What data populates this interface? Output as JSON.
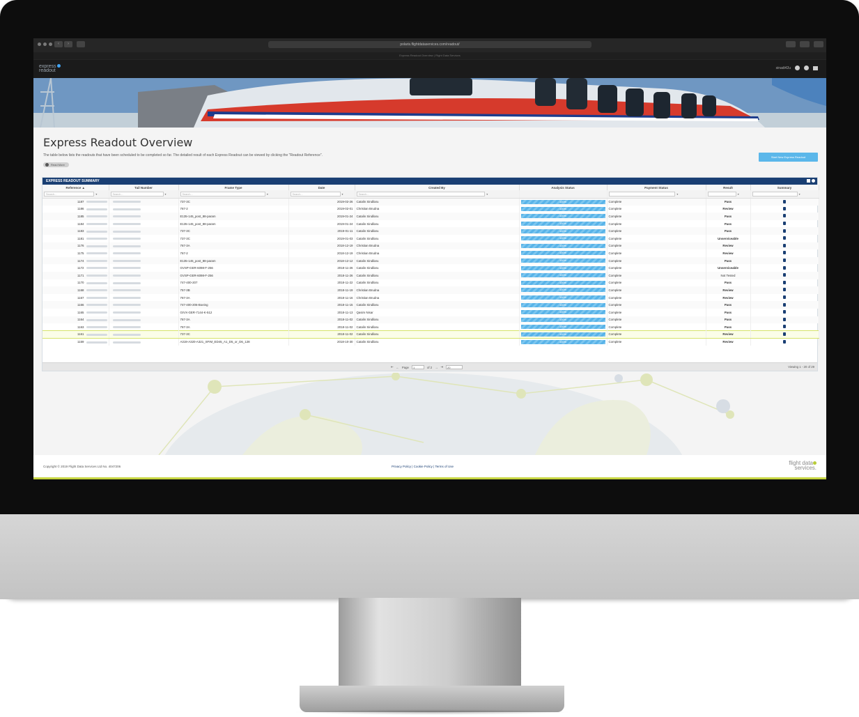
{
  "browser": {
    "url": "polaris.flightdataservices.com/readout/",
    "tab_title": "Express Readout Overview | Flight Data Services"
  },
  "app": {
    "logo_line1": "express",
    "logo_line2": "readout",
    "user": "sinadi42u"
  },
  "page": {
    "title": "Express Readout Overview",
    "intro": "The table below lists the readouts that have been scheduled to be completed so far. The detailed result of each Express Readout can be viewed by clicking the \"Readout Reference\".",
    "read_more": "Read More",
    "start_button": "Start New Express Readout"
  },
  "table": {
    "panel_title": "EXPRESS READOUT SUMMARY",
    "columns": [
      "Reference ▲",
      "Tail Number",
      "Frame Type",
      "Date",
      "Created By",
      "Analysis Status",
      "Payment Status",
      "Result",
      "Summary"
    ],
    "filter_placeholder": "Search...",
    "rows": [
      {
        "ref": "1187",
        "frame": "737-3C",
        "date": "2019-02-26",
        "by": "Catalin Sindilaru",
        "analysis": "100%",
        "payment": "Complete",
        "result": "Pass"
      },
      {
        "ref": "1186",
        "frame": "767-2",
        "date": "2019-02-01",
        "by": "Christian Brudna",
        "analysis": "100%",
        "payment": "Complete",
        "result": "Review"
      },
      {
        "ref": "1185",
        "frame": "E135-145_post_88-param",
        "date": "2019-01-24",
        "by": "Catalin Sindilaru",
        "analysis": "100%",
        "payment": "Complete",
        "result": "Pass"
      },
      {
        "ref": "1184",
        "frame": "E135-145_post_88-param",
        "date": "2019-01-24",
        "by": "Catalin Sindilaru",
        "analysis": "100%",
        "payment": "Complete",
        "result": "Pass"
      },
      {
        "ref": "1183",
        "frame": "737-3C",
        "date": "2019-01-11",
        "by": "Catalin Sindilaru",
        "analysis": "100%",
        "payment": "Complete",
        "result": "Pass"
      },
      {
        "ref": "1181",
        "frame": "737-3C",
        "date": "2019-01-03",
        "by": "Catalin Sindilaru",
        "analysis": "100%",
        "payment": "Complete",
        "result": "Unserviceable"
      },
      {
        "ref": "1176",
        "frame": "767-3A",
        "date": "2018-12-19",
        "by": "Christian Brudna",
        "analysis": "100%",
        "payment": "Complete",
        "result": "Review"
      },
      {
        "ref": "1175",
        "frame": "767-2",
        "date": "2018-12-19",
        "by": "Christian Brudna",
        "analysis": "100%",
        "payment": "Complete",
        "result": "Review"
      },
      {
        "ref": "1174",
        "frame": "E135-145_post_88-param",
        "date": "2018-12-12",
        "by": "Catalin Sindilaru",
        "analysis": "100%",
        "payment": "Complete",
        "result": "Pass"
      },
      {
        "ref": "1172",
        "frame": "GVSP-GER-6098-F-256",
        "date": "2018-11-26",
        "by": "Catalin Sindilaru",
        "analysis": "100%",
        "payment": "Complete",
        "result": "Unserviceable"
      },
      {
        "ref": "1171",
        "frame": "GVSP-GER-6098-F-256",
        "date": "2018-11-26",
        "by": "Catalin Sindilaru",
        "analysis": "100%",
        "payment": "Complete",
        "result": "Not Tested"
      },
      {
        "ref": "1170",
        "frame": "747-400-207",
        "date": "2018-11-22",
        "by": "Catalin Sindilaru",
        "analysis": "100%",
        "payment": "Complete",
        "result": "Pass"
      },
      {
        "ref": "1168",
        "frame": "757-3B",
        "date": "2018-11-19",
        "by": "Christian Brudna",
        "analysis": "100%",
        "payment": "Complete",
        "result": "Review"
      },
      {
        "ref": "1167",
        "frame": "767-3A",
        "date": "2018-11-16",
        "by": "Christian Brudna",
        "analysis": "100%",
        "payment": "Complete",
        "result": "Review"
      },
      {
        "ref": "1166",
        "frame": "747-400-206-Boeing",
        "date": "2018-11-15",
        "by": "Catalin Sindilaru",
        "analysis": "100%",
        "payment": "Complete",
        "result": "Pass"
      },
      {
        "ref": "1165",
        "frame": "GIVX-GER-7144-K-512",
        "date": "2018-11-13",
        "by": "Qasim Nisar",
        "analysis": "100%",
        "payment": "Complete",
        "result": "Pass"
      },
      {
        "ref": "1164",
        "frame": "767-3A",
        "date": "2018-11-02",
        "by": "Catalin Sindilaru",
        "analysis": "100%",
        "payment": "Complete",
        "result": "Pass"
      },
      {
        "ref": "1163",
        "frame": "767-3A",
        "date": "2018-11-02",
        "by": "Catalin Sindilaru",
        "analysis": "100%",
        "payment": "Complete",
        "result": "Pass"
      },
      {
        "ref": "1161",
        "frame": "737-3C",
        "date": "2018-11-02",
        "by": "Catalin Sindilaru",
        "analysis": "100%",
        "payment": "Complete",
        "result": "Review"
      },
      {
        "ref": "1159",
        "frame": "A319-A320-A321_SFIM_ED45_A1_D5_or_D6_128",
        "date": "2018-10-30",
        "by": "Catalin Sindilaru",
        "analysis": "100%",
        "payment": "Complete",
        "result": "Review"
      }
    ],
    "selected_row": 18
  },
  "pager": {
    "page_label": "Page",
    "page_value": "1",
    "of_label": "of 2",
    "per_page": "20",
    "viewing": "Viewing 1 - 20 of 29"
  },
  "footer": {
    "copyright": "Copyright © 2019 Flight Data Services Ltd No. 4047206",
    "links": "Privacy Policy | Cookie Policy | Terms of Use",
    "logo_line1": "flight data",
    "logo_line2": "services."
  },
  "colors": {
    "navy": "#1a3f73",
    "accent_blue": "#5bb7ea",
    "pass": "#3aa53a",
    "review": "#e67e22",
    "unserviceable": "#c0392b",
    "footer_line": "#c7d642"
  }
}
